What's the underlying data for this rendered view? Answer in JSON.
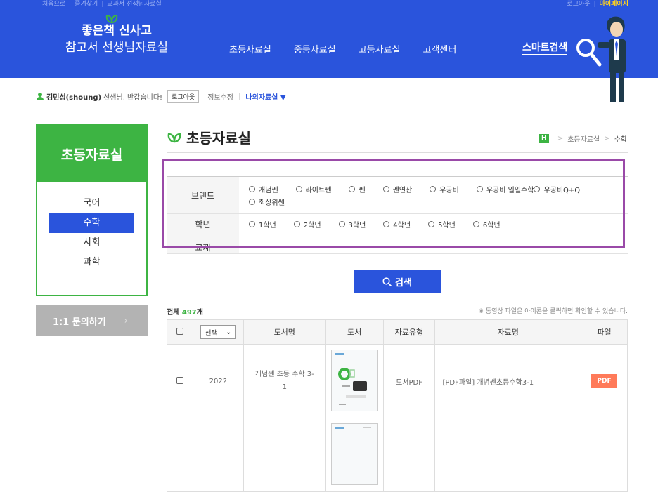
{
  "util": {
    "links": [
      "처음으로",
      "즐겨찾기",
      "교과서 선생님자료실"
    ],
    "logout": "로그아웃",
    "mypage": "마이페이지"
  },
  "logo": {
    "line1": "좋은책 신사고",
    "line2": "참고서 선생님자료실"
  },
  "gnb": [
    "초등자료실",
    "중등자료실",
    "고등자료실",
    "고객센터"
  ],
  "smart_search": "스마트검색",
  "userbar": {
    "name": "김민성(shoung)",
    "greeting": "선생님, 반갑습니다!",
    "logout_button": "로그아웃",
    "edit_info": "정보수정",
    "my_room": "나의자료실 ▼"
  },
  "sidebar": {
    "title": "초등자료실",
    "items": [
      "국어",
      "수학",
      "사회",
      "과학"
    ],
    "active_index": 1
  },
  "qna": {
    "label": "1:1 문의하기",
    "arrow": "›"
  },
  "page": {
    "title": "초등자료실",
    "breadcrumb": {
      "home": "H",
      "level1": "초등자료실",
      "current": "수학"
    }
  },
  "filter": {
    "brand": {
      "label": "브랜드",
      "options": [
        "개념쎈",
        "라이트쎈",
        "쎈",
        "쎈연산",
        "우공비",
        "우공비 일일수학",
        "우공비Q+Q",
        "최상위쎈"
      ]
    },
    "grade": {
      "label": "학년",
      "options": [
        "1학년",
        "2학년",
        "3학년",
        "4학년",
        "5학년",
        "6학년"
      ]
    },
    "textbook": {
      "label": "교재"
    }
  },
  "search_button": "검색",
  "list": {
    "total_prefix": "전체 ",
    "total_count": "497",
    "total_suffix": "개",
    "notice": "※ 동영상 파일은 아이콘을 클릭하면 확인할 수 있습니다.",
    "headers": {
      "select": "선택",
      "book_name": "도서명",
      "book": "도서",
      "type": "자료유형",
      "title": "자료명",
      "file": "파일"
    },
    "rows": [
      {
        "year": "2022",
        "book_name": "개념쎈 초등 수학 3-1",
        "type": "도서PDF",
        "title": "[PDF파일] 개념쎈초등수학3-1",
        "file": "PDF"
      }
    ]
  },
  "colors": {
    "brand_blue": "#2a54dc",
    "green": "#3db443",
    "highlight": "#9a4aa8",
    "pdf": "#ff7a59"
  }
}
